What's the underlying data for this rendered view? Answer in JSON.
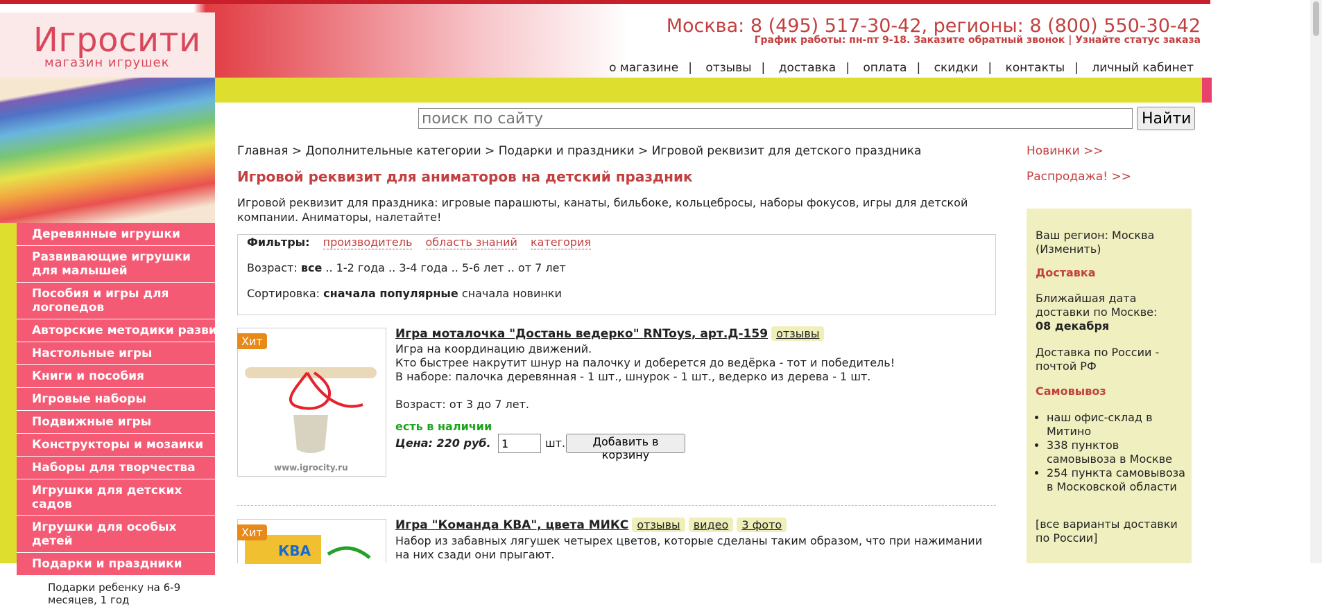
{
  "header": {
    "logo_title": "Игросити",
    "logo_subtitle": "магазин игрушек",
    "phone": "Москва: 8 (495) 517-30-42, регионы: 8 (800) 550-30-42",
    "hours": "График работы: пн-пт 9-18.",
    "callback_link": "Заказите обратный звонок",
    "hours_sep": "|",
    "order_status_link": "Узнайте статус заказа",
    "nav": [
      "о магазине",
      "отзывы",
      "доставка",
      "оплата",
      "скидки",
      "контакты",
      "личный кабинет"
    ],
    "nav_sep": "|"
  },
  "search": {
    "placeholder": "поиск по сайту",
    "button": "Найти"
  },
  "sidebar": {
    "categories": [
      "Деревянные игрушки",
      "Развивающие игрушки для малышей",
      "Пособия и игры для логопедов",
      "Авторские методики развития",
      "Настольные игры",
      "Книги и пособия",
      "Игровые наборы",
      "Подвижные игры",
      "Конструкторы и мозаики",
      "Наборы для творчества",
      "Игрушки для детских садов",
      "Игрушки для особых детей",
      "Подарки и праздники"
    ],
    "subcategory": "Подарки ребенку на 6-9 месяцев, 1 год"
  },
  "breadcrumb": {
    "items": [
      "Главная",
      "Дополнительные категории",
      "Подарки и праздники"
    ],
    "current": "Игровой реквизит для детского праздника",
    "sep": ">"
  },
  "page": {
    "title": "Игровой реквизит для аниматоров на детский праздник",
    "intro": "Игровой реквизит для праздника: игровые парашюты, канаты, бильбоке, кольцебросы, наборы фокусов, игры для детской компании. Аниматоры, налетайте!"
  },
  "filters": {
    "label": "Фильтры:",
    "links": [
      "производитель",
      "область знаний",
      "категория"
    ],
    "age_label": "Возраст:",
    "age_all": "все",
    "age_options": [
      "1-2 года",
      "3-4 года",
      "5-6 лет",
      "от 7 лет"
    ],
    "age_sep": "..",
    "sort_label": "Сортировка:",
    "sort_active": "сначала популярные",
    "sort_other": "сначала новинки"
  },
  "products": [
    {
      "badge": "Хит",
      "title": "Игра моталочка \"Достань ведерко\" RNToys, арт.Д-159",
      "tags": [
        "отзывы"
      ],
      "lines": [
        "Игра на координацию движений.",
        "Кто быстрее накрутит шнур на палочку и доберется до ведёрка - тот и победитель!",
        "В наборе: палочка деревянная - 1 шт., шнурок - 1 шт., ведерко из дерева - 1 шт."
      ],
      "age": "Возраст: от 3 до 7 лет.",
      "stock": "есть в наличии",
      "price": "Цена: 220 руб.",
      "qty": "1",
      "qty_unit": "шт.",
      "cart_button": "Добавить в корзину",
      "watermark": "www.igrocity.ru"
    },
    {
      "badge": "Хит",
      "title": "Игра \"Команда КВА\", цвета МИКС",
      "tags": [
        "отзывы",
        "видео",
        "3 фото"
      ],
      "lines": [
        "Набор из забавных лягушек четырех цветов, которые сделаны таким образом, что при нажимании на них сзади они прыгают."
      ],
      "image_text": "КВА"
    }
  ],
  "right": {
    "new_link": "Новинки >>",
    "sale_link": "Распродажа! >>",
    "region_text": "Ваш регион: Москва",
    "region_change": "Изменить",
    "delivery_head": "Доставка",
    "nearest_link": "Ближайшая дата доставки по Москве",
    "nearest_colon": ":",
    "nearest_date": "08 декабря",
    "russia_link": "Доставка по России - почтой РФ",
    "pickup_head": "Самовывоз",
    "pickup_items": [
      "наш офис-склад в Митино",
      "338 пунктов самовывоза в Москве",
      "254 пункта самовывоза в Московской области"
    ],
    "all_options": "[все варианты доставки по России]"
  },
  "colors": {
    "accent": "#c2403f",
    "sidebar_pink": "#f45a74",
    "yellow": "#dede2e",
    "stock_green": "#1da41d"
  }
}
